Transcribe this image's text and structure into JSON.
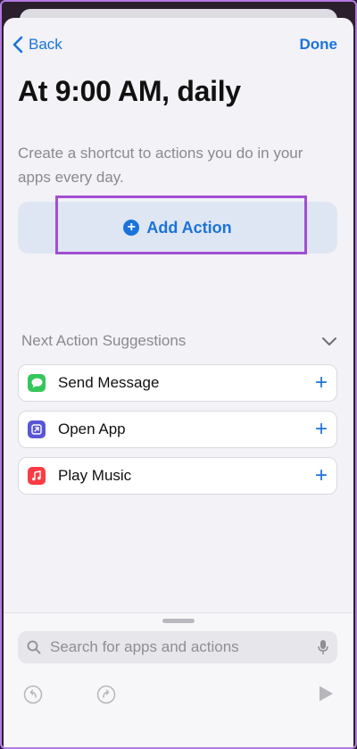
{
  "nav": {
    "back_label": "Back",
    "done_label": "Done"
  },
  "title": "At 9:00 AM, daily",
  "description": "Create a shortcut to actions you do in your apps every day.",
  "add_action": {
    "label": "Add Action"
  },
  "suggestions": {
    "title": "Next Action Suggestions",
    "items": [
      {
        "label": "Send Message",
        "icon": "messages-icon",
        "color": "#34c759"
      },
      {
        "label": "Open App",
        "icon": "open-app-icon",
        "color": "#5856d6"
      },
      {
        "label": "Play Music",
        "icon": "music-icon",
        "color": "#fc3c44"
      }
    ]
  },
  "search": {
    "placeholder": "Search for apps and actions",
    "value": ""
  },
  "colors": {
    "accent": "#1a73d9",
    "highlight": "#a14fd2"
  }
}
